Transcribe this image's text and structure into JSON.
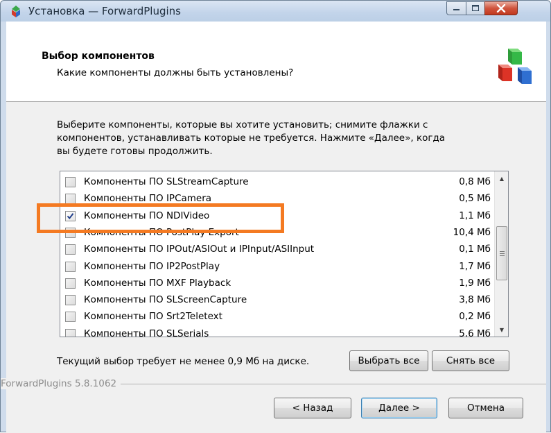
{
  "window": {
    "title": "Установка — ForwardPlugins"
  },
  "header": {
    "title": "Выбор компонентов",
    "subtitle": "Какие компоненты должны быть установлены?"
  },
  "description": {
    "line1": "Выберите компоненты, которые вы хотите установить; снимите флажки с",
    "line2": "компонентов, устанавливать которые не требуется. Нажмите «Далее», когда",
    "line3": "вы будете готовы продолжить."
  },
  "components": [
    {
      "label": "Компоненты ПО SLStreamCapture",
      "size": "0,8 Мб",
      "checked": false
    },
    {
      "label": "Компоненты ПО IPCamera",
      "size": "0,5 Мб",
      "checked": false
    },
    {
      "label": "Компоненты ПО NDIVideo",
      "size": "1,1 Мб",
      "checked": true
    },
    {
      "label": "Компоненты ПО PostPlay Export",
      "size": "10,4 Мб",
      "checked": false
    },
    {
      "label": "Компоненты ПО IPOut/ASIOut и IPInput/ASIInput",
      "size": "0,1 Мб",
      "checked": false
    },
    {
      "label": "Компоненты ПО IP2PostPlay",
      "size": "1,7 Мб",
      "checked": false
    },
    {
      "label": "Компоненты ПО MXF Playback",
      "size": "1,9 Мб",
      "checked": false
    },
    {
      "label": "Компоненты ПО SLScreenCapture",
      "size": "3,8 Мб",
      "checked": false
    },
    {
      "label": "Компоненты ПО Srt2Teletext",
      "size": "0,2 Мб",
      "checked": false
    },
    {
      "label": "Компоненты ПО SLSerials",
      "size": "5,6 Мб",
      "checked": false
    }
  ],
  "status": {
    "disk_requirement": "Текущий выбор требует не менее 0,9 Мб на диске."
  },
  "buttons": {
    "select_all": "Выбрать все",
    "clear_all": "Снять все",
    "back": "< Назад",
    "next": "Далее >",
    "cancel": "Отмена"
  },
  "brand": {
    "version_text": "ForwardPlugins 5.8.1062"
  },
  "colors": {
    "highlight": "#f47a22",
    "close_button": "#c2391f"
  }
}
